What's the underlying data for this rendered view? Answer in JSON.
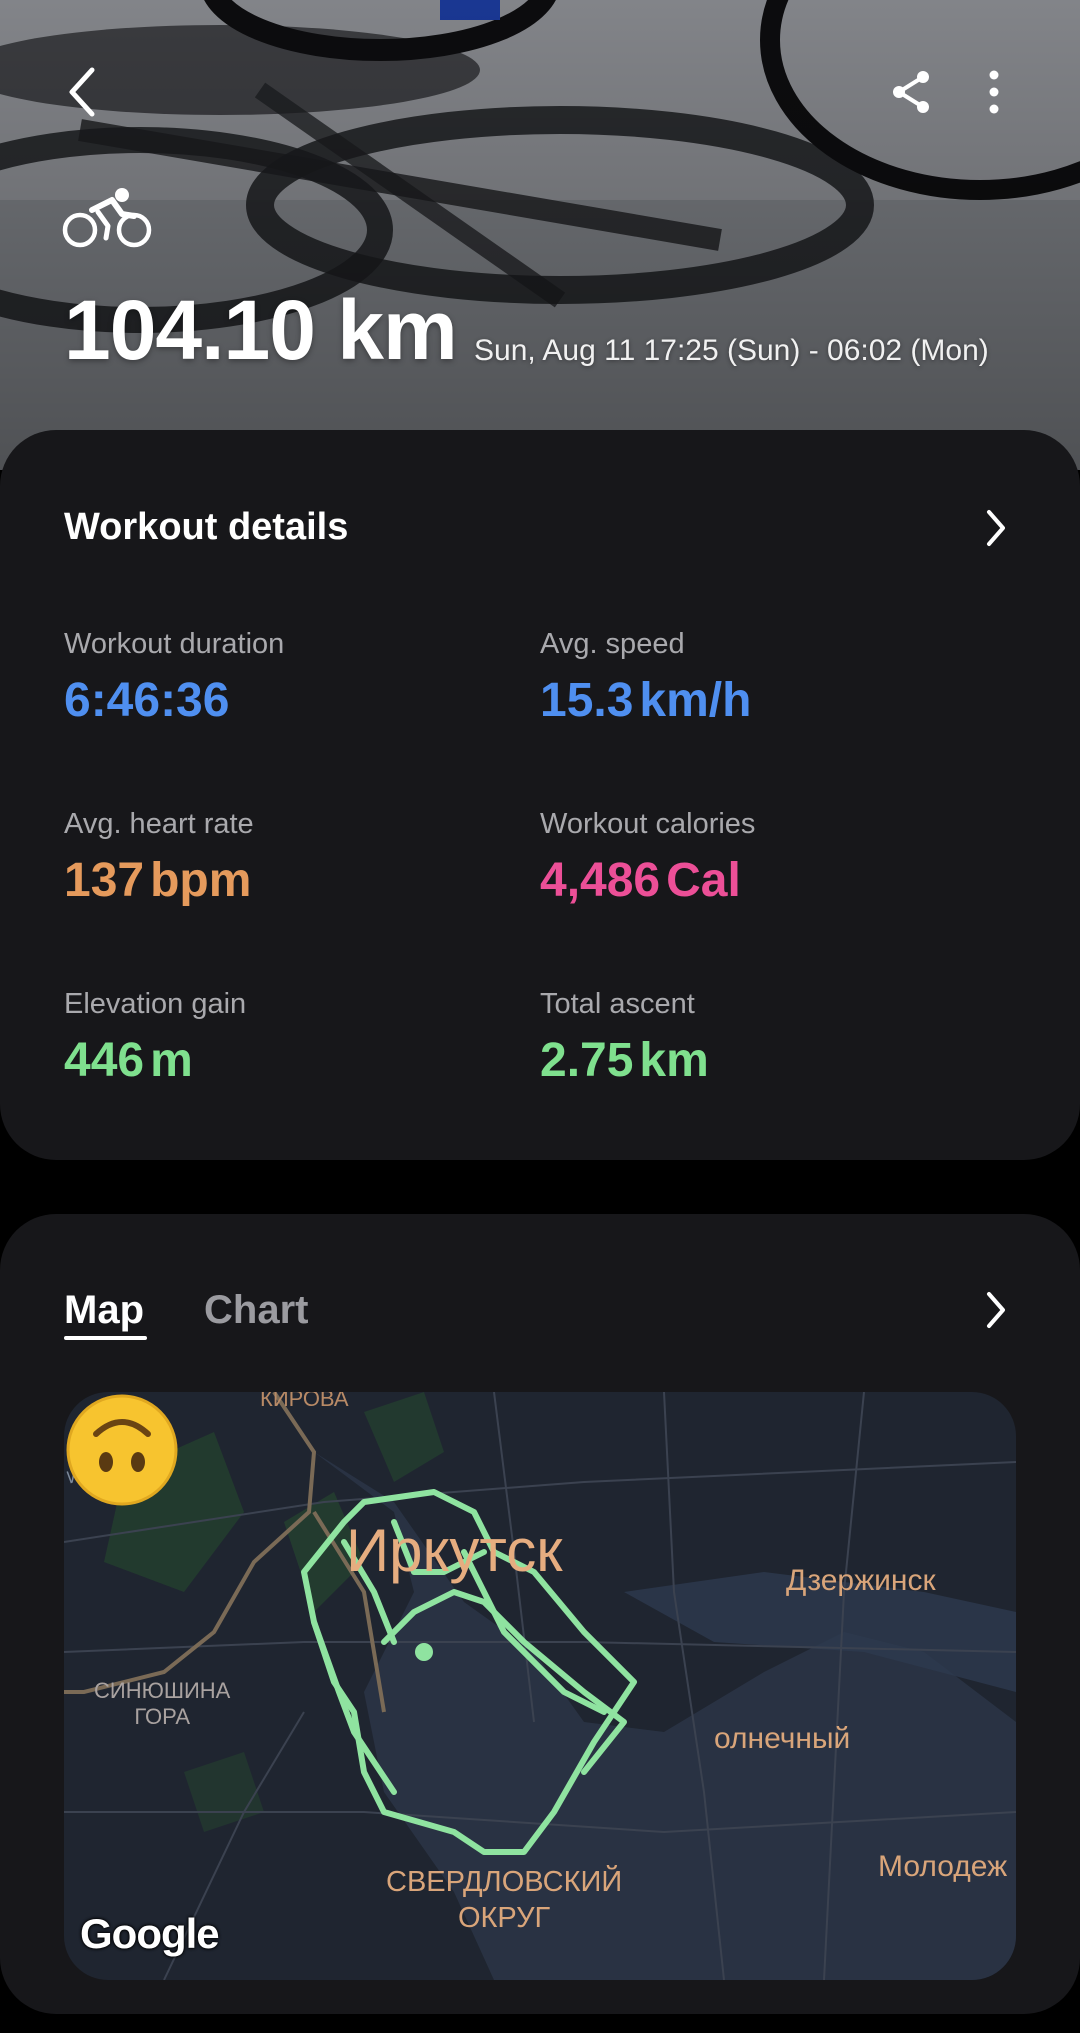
{
  "header": {
    "distance": "104.10 km",
    "date_range": "Sun, Aug 11 17:25 (Sun) - 06:02 (Mon)",
    "back_icon": "chevron-left-icon",
    "share_icon": "share-icon",
    "more_icon": "more-vertical-icon",
    "activity_icon": "cycling-icon"
  },
  "workout_details": {
    "title": "Workout details",
    "metrics": [
      {
        "label": "Workout duration",
        "value": "6:46:36",
        "unit": "",
        "color": "#4f8ff0"
      },
      {
        "label": "Avg. speed",
        "value": "15.3",
        "unit": "km/h",
        "color": "#4f8ff0"
      },
      {
        "label": "Avg. heart rate",
        "value": "137",
        "unit": "bpm",
        "color": "#e59a5c"
      },
      {
        "label": "Workout calories",
        "value": "4,486",
        "unit": "Cal",
        "color": "#ec4f97"
      },
      {
        "label": "Elevation gain",
        "value": "446",
        "unit": "m",
        "color": "#7fe08e"
      },
      {
        "label": "Total ascent",
        "value": "2.75",
        "unit": "km",
        "color": "#7fe08e"
      }
    ]
  },
  "tabs": {
    "map_label": "Map",
    "chart_label": "Chart",
    "active": "Map"
  },
  "map": {
    "labels": {
      "kirova": "КИРОВА",
      "irkut": "Иркут",
      "city": "Иркутск",
      "dzerzhinsk": "Дзержинск",
      "sinyushina": "СИНЮШИНА\nГОРА",
      "solnechny": "олнечный",
      "sverdlovsky": "СВЕРДЛОВСКИЙ\nОКРУГ",
      "molodezh": "Молодеж"
    },
    "attribution": "Google",
    "route_color": "#8fe3a0",
    "marker": "upside-down-face-emoji"
  }
}
